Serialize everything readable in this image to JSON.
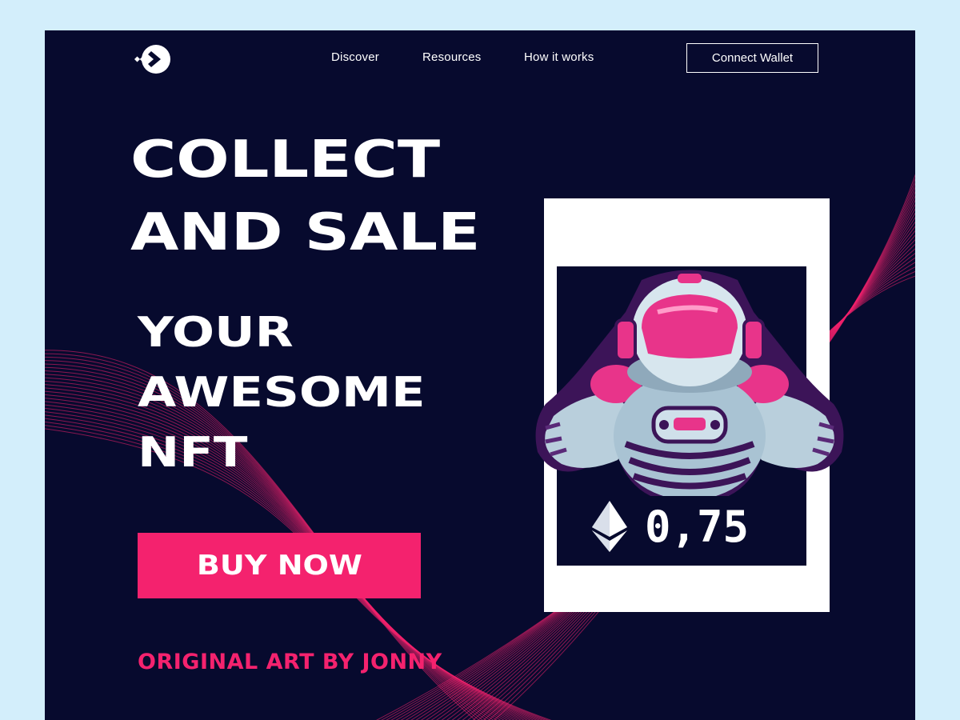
{
  "nav": {
    "logo_icon": "arrow-logo-icon",
    "links": [
      "Discover",
      "Resources",
      "How it works"
    ],
    "cta_label": "Connect Wallet"
  },
  "hero": {
    "headline_lines": [
      "COLLECT",
      "AND SALE",
      "YOUR",
      "AWESOME",
      "NFT"
    ],
    "button_label": "BUY NOW",
    "tagline": "ORIGINAL ART BY JONNY"
  },
  "nft_card": {
    "artwork_icon": "astronaut-mascot-icon",
    "currency_icon": "ethereum-icon",
    "price": "0,75"
  },
  "colors": {
    "page_background": "#d3eefb",
    "hero_background": "#070a2e",
    "accent_pink": "#f4226e",
    "text_white": "#ffffff",
    "card_white": "#ffffff"
  }
}
